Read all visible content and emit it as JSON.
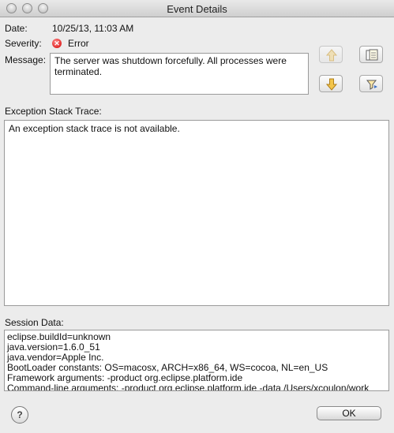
{
  "window": {
    "title": "Event Details"
  },
  "fields": {
    "date_label": "Date:",
    "date_value": "10/25/13, 11:03 AM",
    "severity_label": "Severity:",
    "severity_value": "Error",
    "message_label": "Message:",
    "message_value": "The server was shutdown forcefully. All processes were terminated."
  },
  "trace": {
    "label": "Exception Stack Trace:",
    "text": "An exception stack trace is not available."
  },
  "session": {
    "label": "Session Data:",
    "lines": [
      "eclipse.buildId=unknown",
      "java.version=1.6.0_51",
      "java.vendor=Apple Inc.",
      "BootLoader constants: OS=macosx, ARCH=x86_64, WS=cocoa, NL=en_US",
      "Framework arguments:  -product org.eclipse.platform.ide",
      "Command-line arguments:  -product org.eclipse.platform.ide -data /Users/xcoulon/work"
    ]
  },
  "buttons": {
    "ok": "OK",
    "help": "?"
  },
  "colors": {
    "error": "#d40000",
    "arrow": "#e8b43a"
  },
  "icons": [
    "up-arrow-icon",
    "down-arrow-icon",
    "copy-icon",
    "filter-icon",
    "error-icon",
    "help-icon"
  ]
}
